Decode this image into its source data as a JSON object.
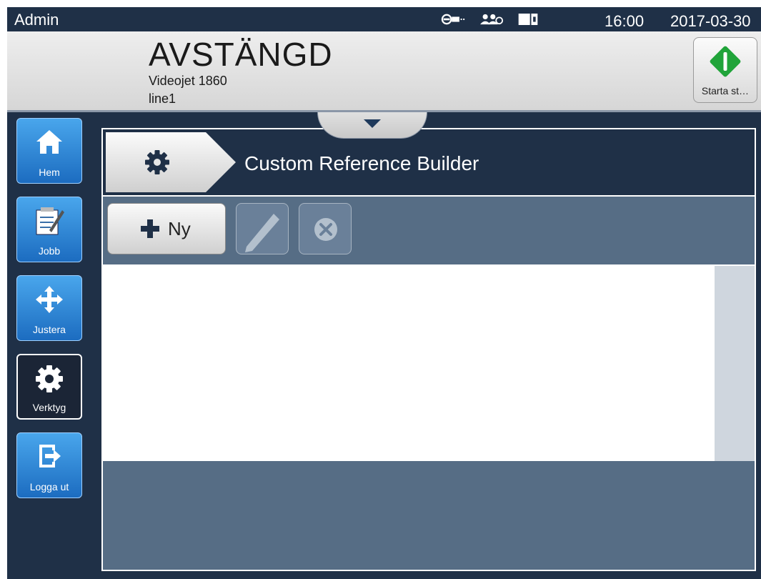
{
  "status_bar": {
    "user": "Admin",
    "time": "16:00",
    "date": "2017-03-30",
    "icons": [
      "connection-icon",
      "users-icon",
      "ink-cartridge-icon"
    ]
  },
  "header": {
    "state": "AVSTÄNGD",
    "model": "Videojet 1860",
    "line": "line1",
    "start_button_label": "Starta st…",
    "start_color": "#21a43a"
  },
  "nav": {
    "items": [
      {
        "label": "Hem",
        "icon": "home-icon"
      },
      {
        "label": "Jobb",
        "icon": "job-clipboard-icon"
      },
      {
        "label": "Justera",
        "icon": "move-arrows-icon"
      },
      {
        "label": "Verktyg",
        "icon": "gear-icon",
        "active": true
      },
      {
        "label": "Logga ut",
        "icon": "logout-icon"
      }
    ]
  },
  "page": {
    "title": "Custom Reference Builder",
    "title_icon": "gear-icon"
  },
  "toolbar": {
    "new_label": "Ny",
    "edit_icon": "pencil-icon",
    "delete_icon": "delete-circle-icon"
  },
  "colors": {
    "dark_navy": "#1f3047",
    "panel_slate": "#566d85",
    "nav_blue": "#2a86d8"
  }
}
